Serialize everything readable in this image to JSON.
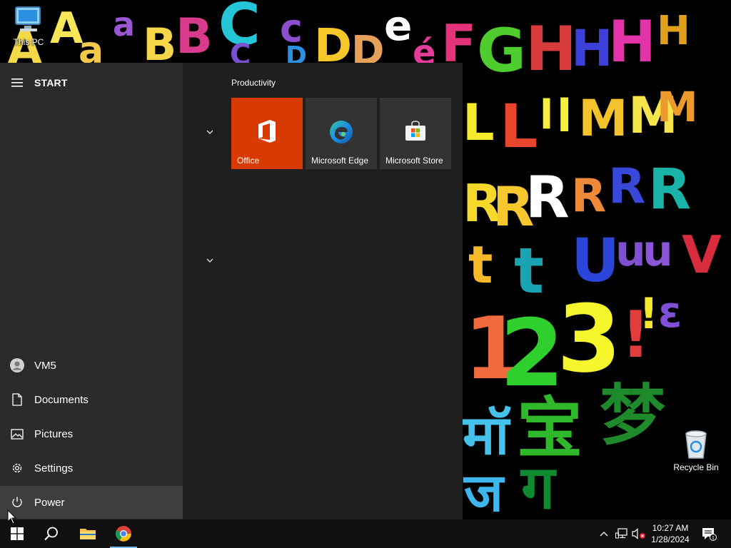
{
  "desktop": {
    "icons": [
      {
        "label": "This PC"
      },
      {
        "label": "Recycle Bin"
      }
    ],
    "wallpaper_glyphs": {
      "row1": "AaaBBCcDDeéFGHHHH",
      "row2": "LLlMMM",
      "row3": "RRRRRR",
      "row4": "ttuuuV",
      "row5": "123!!ɛ",
      "row6": "मॉ宝梦",
      "row7": "जग"
    }
  },
  "start_menu": {
    "title": "START",
    "menu_icon": "hamburger-icon",
    "rail": {
      "user": {
        "label": "VM5",
        "icon": "user-avatar-icon"
      },
      "documents": {
        "label": "Documents",
        "icon": "document-icon"
      },
      "pictures": {
        "label": "Pictures",
        "icon": "pictures-icon"
      },
      "settings": {
        "label": "Settings",
        "icon": "gear-icon"
      },
      "power": {
        "label": "Power",
        "icon": "power-icon"
      }
    },
    "tiles_group": {
      "title": "Productivity",
      "tiles": [
        {
          "label": "Office",
          "icon": "office-icon",
          "color": "#d83b01"
        },
        {
          "label": "Microsoft Edge",
          "icon": "edge-icon",
          "color": "#333333"
        },
        {
          "label": "Microsoft Store",
          "icon": "store-icon",
          "color": "#333333"
        }
      ]
    }
  },
  "taskbar": {
    "start_icon": "windows-logo-icon",
    "search_icon": "search-icon",
    "pinned": [
      {
        "name": "File Explorer",
        "icon": "folder-icon"
      },
      {
        "name": "Google Chrome",
        "icon": "chrome-icon",
        "active": true
      }
    ],
    "tray": {
      "time": "10:27 AM",
      "date": "1/28/2024",
      "notification_count": "1"
    }
  },
  "colors": {
    "start_bg": "#1f1f1f",
    "rail_bg": "#2b2b2b",
    "office_orange": "#d83b01",
    "taskbar_bg": "#101010",
    "accent": "#76b9ed"
  }
}
